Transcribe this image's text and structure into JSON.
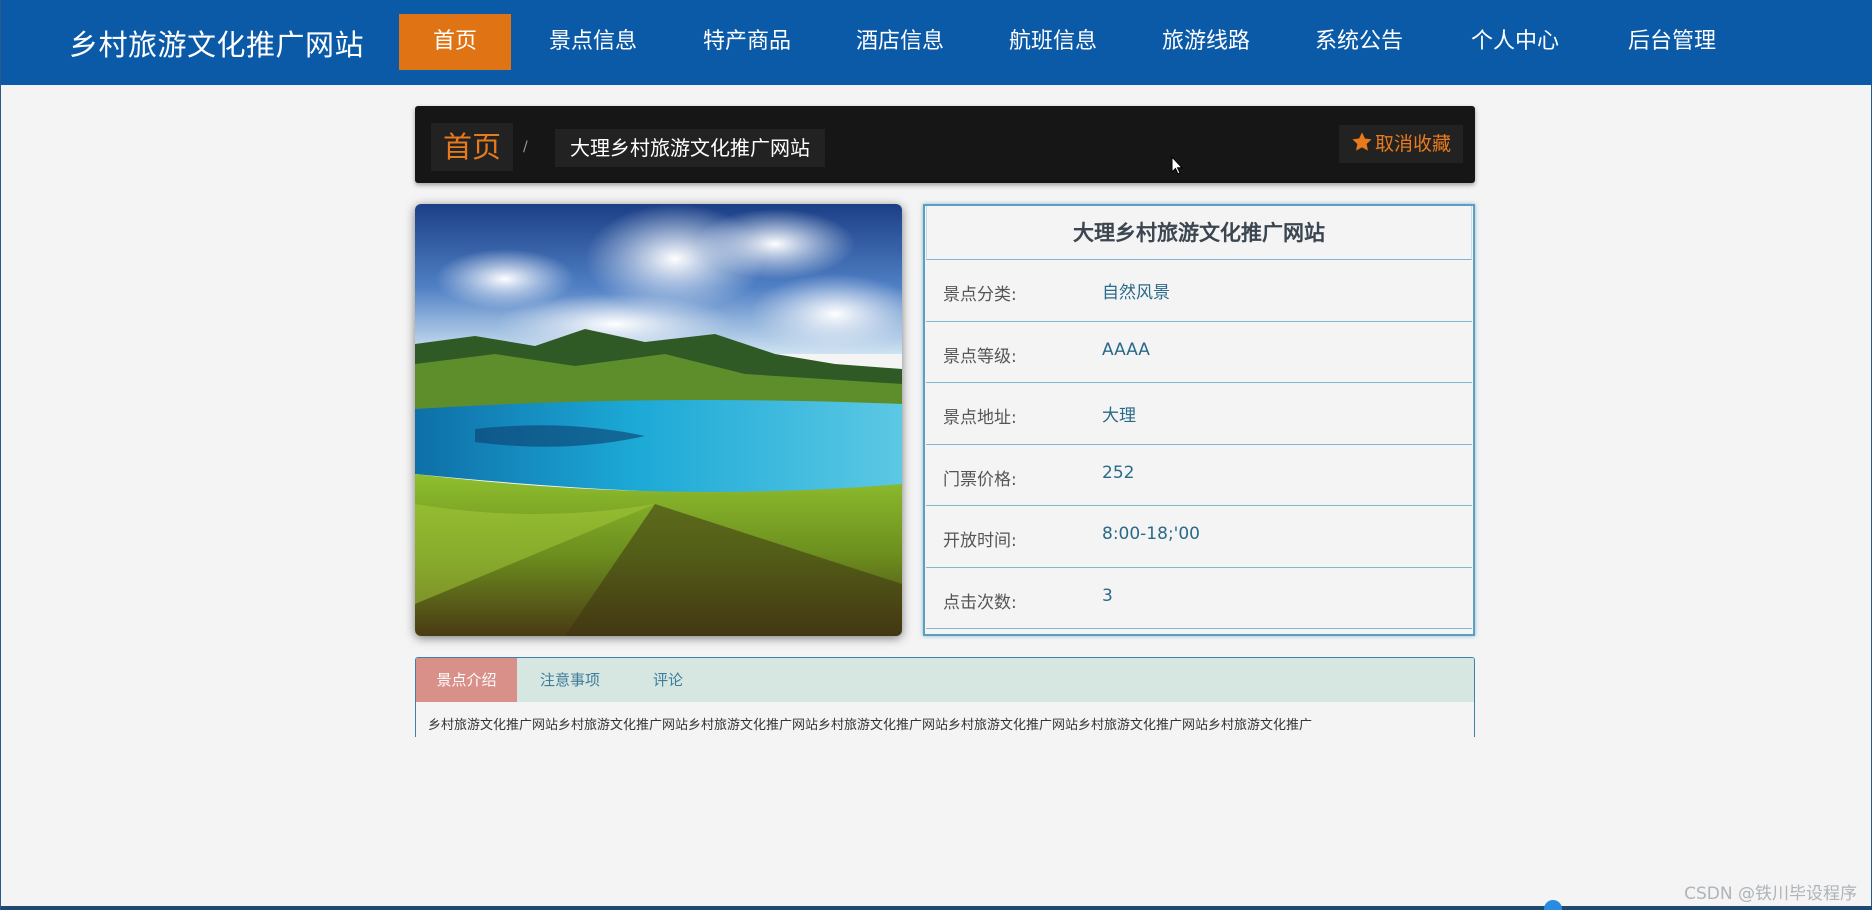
{
  "header": {
    "site_title": "乡村旅游文化推广网站",
    "nav": [
      {
        "label": "首页",
        "active": true
      },
      {
        "label": "景点信息",
        "active": false
      },
      {
        "label": "特产商品",
        "active": false
      },
      {
        "label": "酒店信息",
        "active": false
      },
      {
        "label": "航班信息",
        "active": false
      },
      {
        "label": "旅游线路",
        "active": false
      },
      {
        "label": "系统公告",
        "active": false
      },
      {
        "label": "个人中心",
        "active": false
      },
      {
        "label": "后台管理",
        "active": false
      }
    ]
  },
  "breadcrumb": {
    "home": "首页",
    "separator": "/",
    "current": "大理乡村旅游文化推广网站",
    "favorite_label": "取消收藏",
    "favorite_icon": "star-icon"
  },
  "detail": {
    "title": "大理乡村旅游文化推广网站",
    "rows": [
      {
        "label": "景点分类:",
        "value": "自然风景"
      },
      {
        "label": "景点等级:",
        "value": "AAAA"
      },
      {
        "label": "景点地址:",
        "value": "大理"
      },
      {
        "label": "门票价格:",
        "value": "252"
      },
      {
        "label": "开放时间:",
        "value": "8:00-18;'00"
      },
      {
        "label": "点击次数:",
        "value": "3"
      }
    ]
  },
  "tabs": {
    "items": [
      {
        "label": "景点介绍",
        "active": true
      },
      {
        "label": "注意事项",
        "active": false
      },
      {
        "label": "评论",
        "active": false
      }
    ],
    "content": "乡村旅游文化推广网站乡村旅游文化推广网站乡村旅游文化推广网站乡村旅游文化推广网站乡村旅游文化推广网站乡村旅游文化推广网站乡村旅游文化推广"
  },
  "watermark": "CSDN @铁川毕设程序",
  "colors": {
    "nav_bg": "#0b5aa8",
    "nav_active": "#e07414",
    "accent_orange": "#e77a1c",
    "tab_active": "#d89088",
    "value_text": "#2a6a88"
  }
}
